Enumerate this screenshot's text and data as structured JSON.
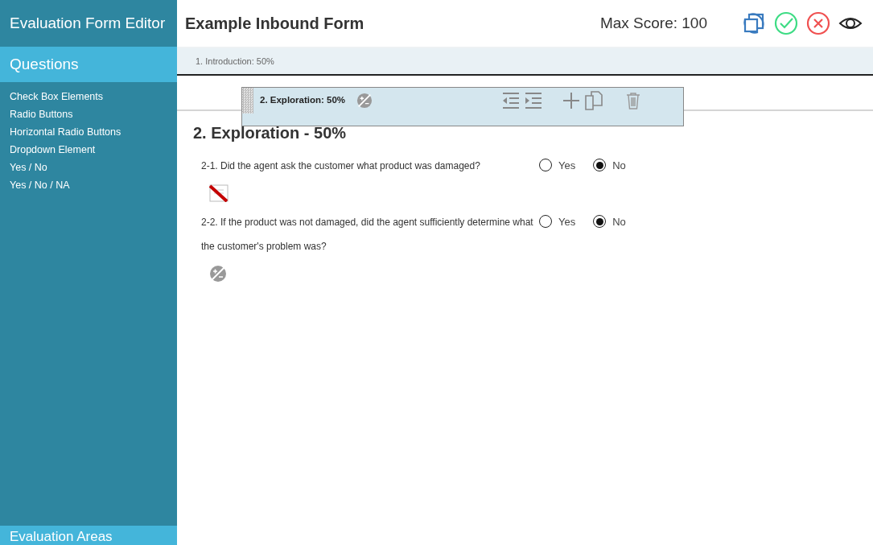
{
  "sidebar": {
    "title": "Evaluation Form Editor",
    "section_title": "Questions",
    "items": [
      "Check Box Elements",
      "Radio Buttons",
      "Horizontal Radio Buttons",
      "Dropdown Element",
      "Yes / No",
      "Yes / No / NA"
    ],
    "footer_title": "Evaluation Areas"
  },
  "header": {
    "title": "Example Inbound Form",
    "max_score": "Max Score: 100"
  },
  "sections": [
    {
      "label": "1. Introduction: 50%"
    }
  ],
  "drag_bar": {
    "label": "2. Exploration: 50%"
  },
  "section_heading": "2. Exploration - 50%",
  "questions": [
    {
      "text": "2-1. Did the agent ask the customer what product was damaged?",
      "kind": "comment-disabled",
      "options": [
        {
          "label": "Yes",
          "selected": false
        },
        {
          "label": "No",
          "selected": true
        }
      ]
    },
    {
      "text": "2-2. If the product was not damaged, did the agent sufficiently determine what the customer's problem was?",
      "kind": "score-adjust",
      "options": [
        {
          "label": "Yes",
          "selected": false
        },
        {
          "label": "No",
          "selected": true
        }
      ]
    }
  ]
}
